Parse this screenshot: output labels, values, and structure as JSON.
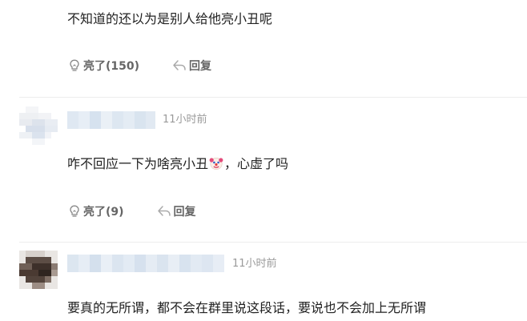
{
  "comments": [
    {
      "text": "不知道的还以为是别人给他亮小丑呢",
      "like_label": "亮了(150)",
      "reply_label": "回复"
    },
    {
      "timestamp": "11小时前",
      "text_before_emoji": "咋不回应一下为啥亮小丑",
      "emoji": "clown-face-emoji",
      "text_after_emoji": "，心虚了吗",
      "like_label": "亮了(9)",
      "reply_label": "回复"
    },
    {
      "timestamp": "11小时前",
      "text": "要真的无所谓，都不会在群里说这段话，要说也不会加上无所谓"
    }
  ],
  "colors": {
    "text": "#222222",
    "action": "#666666",
    "timestamp": "#9a9a9a",
    "divider": "#ececec"
  },
  "icons": {
    "like": "lightbulb-icon",
    "reply": "reply-arrow-icon"
  }
}
